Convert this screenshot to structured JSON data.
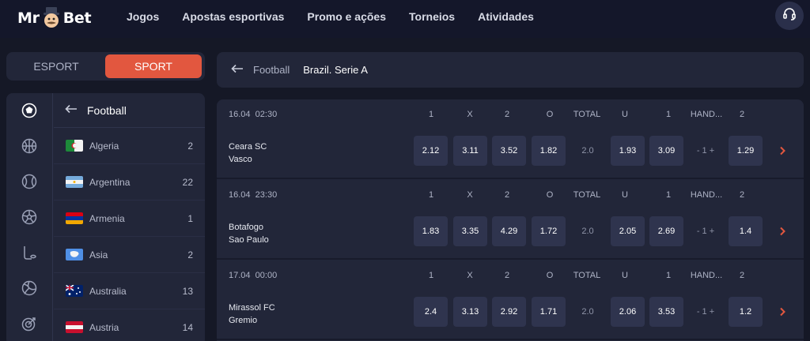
{
  "header": {
    "logo_left": "Mr",
    "logo_right": "Bet",
    "nav": [
      "Jogos",
      "Apostas esportivas",
      "Promo e ações",
      "Torneios",
      "Atividades"
    ],
    "support_icon": "headset-icon"
  },
  "mode_toggle": {
    "esport": "ESPORT",
    "sport": "SPORT",
    "active": "SPORT",
    "active_color": "#e2573f"
  },
  "sidebar": {
    "sport_icons": [
      "football-icon",
      "basketball-icon",
      "tennis-icon",
      "soccer-ball-icon",
      "hockey-icon",
      "volleyball-icon",
      "darts-icon"
    ],
    "title": "Football",
    "countries": [
      {
        "name": "Algeria",
        "count": "2"
      },
      {
        "name": "Argentina",
        "count": "22"
      },
      {
        "name": "Armenia",
        "count": "1"
      },
      {
        "name": "Asia",
        "count": "2"
      },
      {
        "name": "Australia",
        "count": "13"
      },
      {
        "name": "Austria",
        "count": "14"
      }
    ]
  },
  "breadcrumb": {
    "parent": "Football",
    "current": "Brazil. Serie A"
  },
  "market_headers": [
    "1",
    "X",
    "2",
    "O",
    "TOTAL",
    "U",
    "1",
    "HAND...",
    "2"
  ],
  "events": [
    {
      "date": "16.04",
      "time": "02:30",
      "home": "Ceara SC",
      "away": "Vasco",
      "odds": [
        "2.12",
        "3.11",
        "3.52",
        "1.82",
        "2.0",
        "1.93",
        "3.09",
        "- 1 +",
        "1.29"
      ]
    },
    {
      "date": "16.04",
      "time": "23:30",
      "home": "Botafogo",
      "away": "Sao Paulo",
      "odds": [
        "1.83",
        "3.35",
        "4.29",
        "1.72",
        "2.0",
        "2.05",
        "2.69",
        "- 1 +",
        "1.4"
      ]
    },
    {
      "date": "17.04",
      "time": "00:00",
      "home": "Mirassol FC",
      "away": "Gremio",
      "odds": [
        "2.4",
        "3.13",
        "2.92",
        "1.71",
        "2.0",
        "2.06",
        "3.53",
        "- 1 +",
        "1.2"
      ]
    }
  ]
}
